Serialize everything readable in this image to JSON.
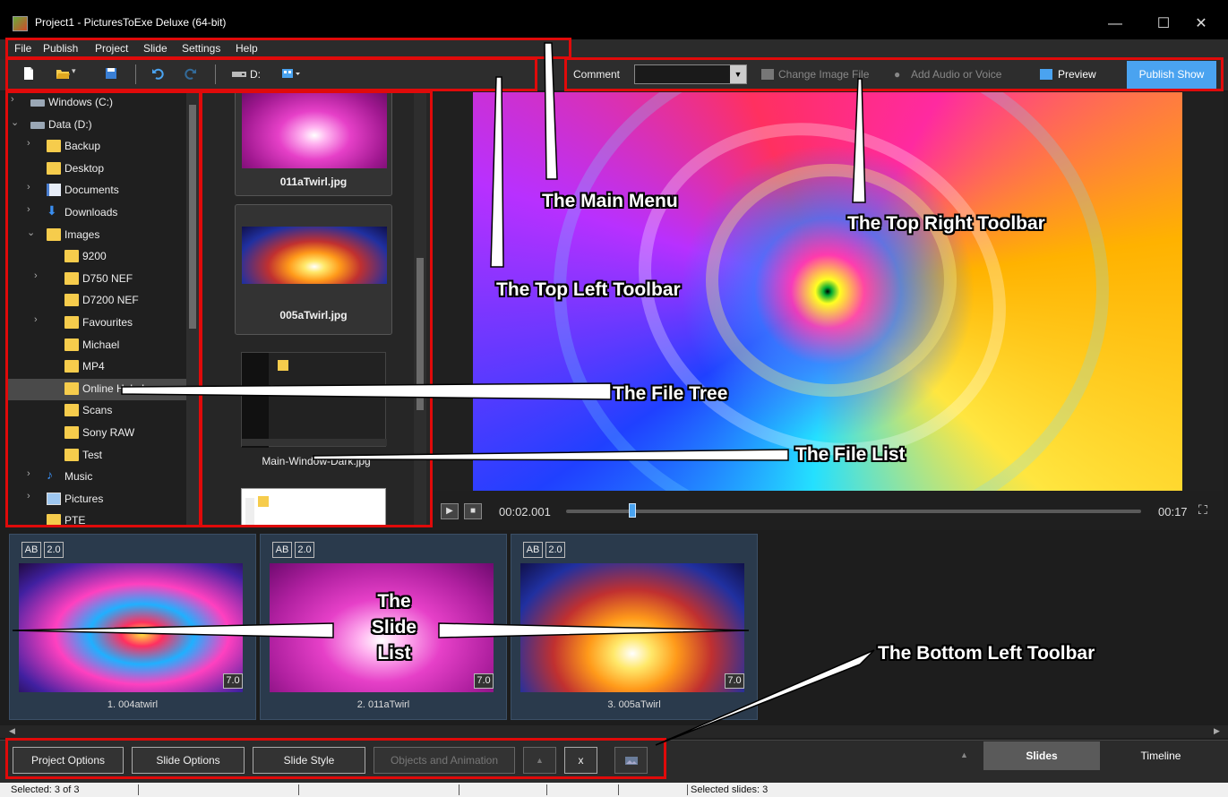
{
  "window": {
    "title": "Project1 - PicturesToExe Deluxe (64-bit)",
    "minimize": "—",
    "maximize": "☐",
    "close": "✕"
  },
  "menu": [
    "File",
    "Publish",
    "Project",
    "Slide",
    "Settings",
    "Help"
  ],
  "top_left_toolbar": {
    "drive_label": "D:"
  },
  "top_right_toolbar": {
    "comment_label": "Comment",
    "comment_value": "",
    "change_image_label": "Change Image File",
    "add_audio_label": "Add Audio or Voice",
    "preview_label": "Preview",
    "publish_label": "Publish Show"
  },
  "file_tree": [
    {
      "label": "Windows (C:)",
      "icon": "drive-icon",
      "chevron": ">"
    },
    {
      "label": "Data (D:)",
      "icon": "drive-icon",
      "chevron": "v"
    },
    {
      "label": "Backup",
      "icon": "folder-icon",
      "chevron": ">"
    },
    {
      "label": "Desktop",
      "icon": "folder-icon",
      "chevron": ""
    },
    {
      "label": "Documents",
      "icon": "documents-icon",
      "chevron": ">"
    },
    {
      "label": "Downloads",
      "icon": "downloads-icon",
      "chevron": ">"
    },
    {
      "label": "Images",
      "icon": "folder-icon",
      "chevron": "v"
    },
    {
      "label": "9200",
      "icon": "folder-icon",
      "chevron": ""
    },
    {
      "label": "D750 NEF",
      "icon": "folder-icon",
      "chevron": ">"
    },
    {
      "label": "D7200 NEF",
      "icon": "folder-icon",
      "chevron": ""
    },
    {
      "label": "Favourites",
      "icon": "folder-icon",
      "chevron": ">"
    },
    {
      "label": "Michael",
      "icon": "folder-icon",
      "chevron": ""
    },
    {
      "label": "MP4",
      "icon": "folder-icon",
      "chevron": ""
    },
    {
      "label": "Online Help Images",
      "icon": "folder-icon",
      "chevron": "",
      "selected": true
    },
    {
      "label": "Scans",
      "icon": "folder-icon",
      "chevron": ""
    },
    {
      "label": "Sony RAW",
      "icon": "folder-icon",
      "chevron": ""
    },
    {
      "label": "Test",
      "icon": "folder-icon",
      "chevron": ""
    },
    {
      "label": "Music",
      "icon": "music-icon",
      "chevron": ">"
    },
    {
      "label": "Pictures",
      "icon": "pictures-icon",
      "chevron": ">"
    },
    {
      "label": "PTE",
      "icon": "folder-icon",
      "chevron": ""
    }
  ],
  "file_list": [
    {
      "name": "011aTwirl.jpg"
    },
    {
      "name": "005aTwirl.jpg"
    },
    {
      "name": "Main-Window-Dark.jpg"
    }
  ],
  "playback": {
    "current_time": "00:02.001",
    "total_time": "00:17",
    "progress": 0.115
  },
  "slides": [
    {
      "name": "1. 004atwirl",
      "badge_ab": "AB",
      "badge_trans": "2.0",
      "duration": "7.0"
    },
    {
      "name": "2. 011aTwirl",
      "badge_ab": "AB",
      "badge_trans": "2.0",
      "duration": "7.0"
    },
    {
      "name": "3. 005aTwirl",
      "badge_ab": "AB",
      "badge_trans": "2.0",
      "duration": "7.0"
    }
  ],
  "bottom_toolbar": {
    "project_options": "Project Options",
    "slide_options": "Slide Options",
    "slide_style": "Slide Style",
    "objects_animation": "Objects and Animation",
    "up": "▲",
    "delete": "x"
  },
  "view_tabs": {
    "slides": "Slides",
    "timeline": "Timeline",
    "arrow": "▲"
  },
  "status": {
    "selected": "Selected: 3 of 3",
    "selected_slides": "Selected slides: 3"
  },
  "callouts": {
    "main_menu": "The Main Menu",
    "top_right_toolbar": "The Top Right Toolbar",
    "top_left_toolbar": "The Top Left Toolbar",
    "file_tree": "The File Tree",
    "file_list": "The File List",
    "slide_list_1": "The",
    "slide_list_2": "Slide",
    "slide_list_3": "List",
    "bottom_left_toolbar": "The Bottom Left Toolbar"
  },
  "colors": {
    "accent": "#4aa3f0",
    "highlight": "#e00a0a",
    "folder": "#f6cc4c"
  }
}
